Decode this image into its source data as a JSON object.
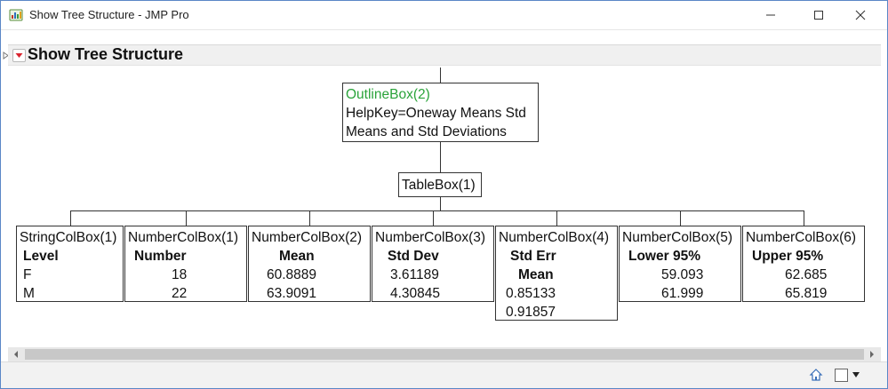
{
  "window": {
    "title": "Show Tree Structure - JMP Pro"
  },
  "outline": {
    "title": "Show Tree Structure"
  },
  "tree": {
    "outline_box": {
      "name": "OutlineBox(2)",
      "helpkey": "HelpKey=Oneway Means Std",
      "caption": "Means and Std Deviations",
      "name_color": "#2aa33a"
    },
    "table_box": {
      "name": "TableBox(1)"
    },
    "columns": [
      {
        "name": "StringColBox(1)",
        "header": [
          "Level"
        ],
        "values": [
          "F",
          "M"
        ]
      },
      {
        "name": "NumberColBox(1)",
        "header": [
          "Number"
        ],
        "values": [
          "18",
          "22"
        ]
      },
      {
        "name": "NumberColBox(2)",
        "header": [
          "Mean"
        ],
        "values": [
          "60.8889",
          "63.9091"
        ]
      },
      {
        "name": "NumberColBox(3)",
        "header": [
          "Std Dev"
        ],
        "values": [
          "3.61189",
          "4.30845"
        ]
      },
      {
        "name": "NumberColBox(4)",
        "header": [
          "Std Err",
          "Mean"
        ],
        "values": [
          "0.85133",
          "0.91857"
        ]
      },
      {
        "name": "NumberColBox(5)",
        "header": [
          "Lower 95%"
        ],
        "values": [
          "59.093",
          "61.999"
        ]
      },
      {
        "name": "NumberColBox(6)",
        "header": [
          "Upper 95%"
        ],
        "values": [
          "62.685",
          "65.819"
        ]
      }
    ]
  },
  "icons": {
    "app": "jmp-app-icon",
    "minimize": "minimize-icon",
    "maximize": "maximize-icon",
    "close": "close-icon",
    "red_triangle": "red-triangle-menu-icon",
    "disclosure": "disclosure-triangle-icon",
    "home": "home-icon",
    "checkbox": "checkbox-icon",
    "dropdown": "chevron-down-icon"
  }
}
